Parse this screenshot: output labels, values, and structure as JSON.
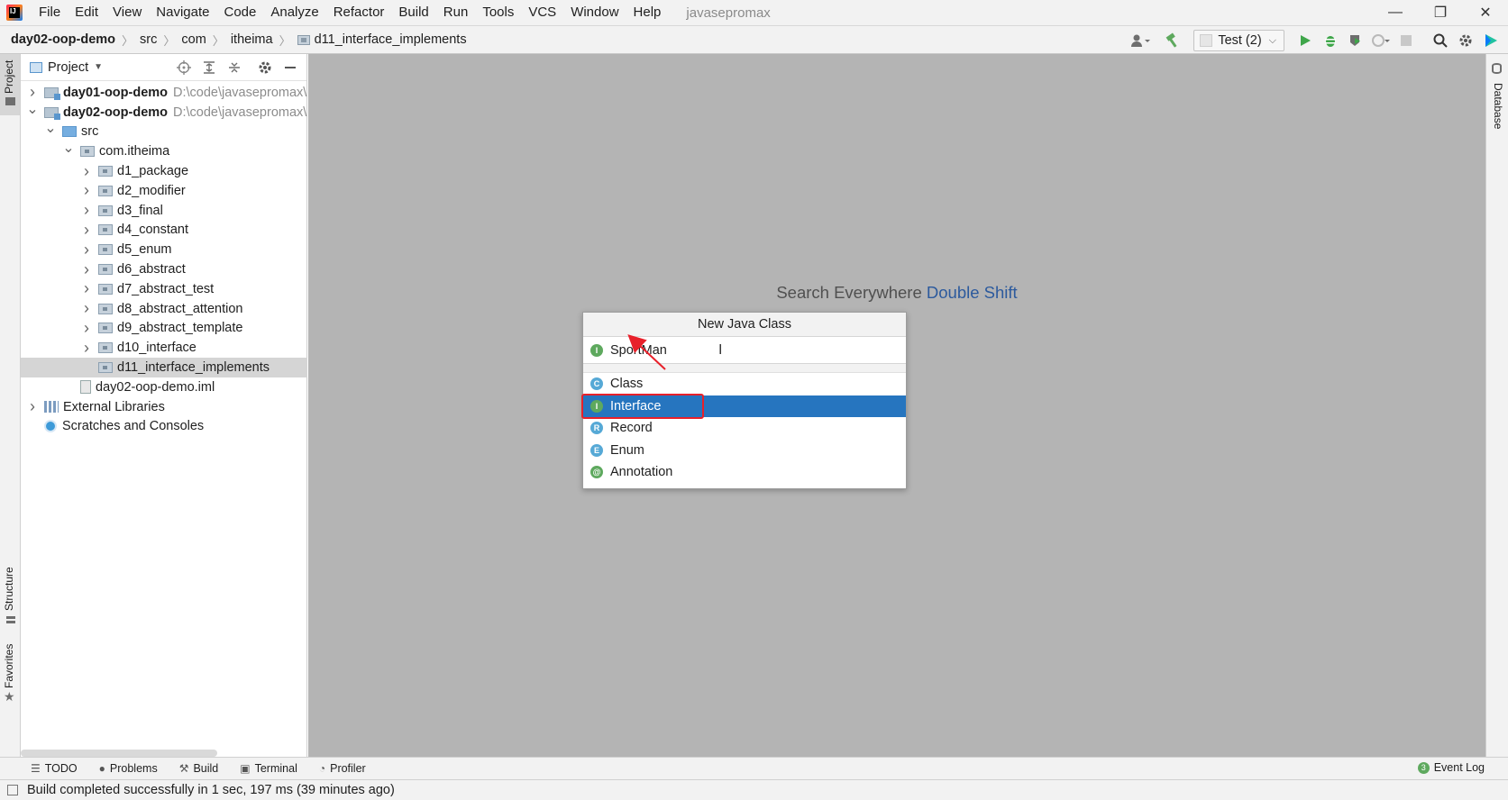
{
  "app": {
    "logo_text": "IJ",
    "project_title": "javasepromax"
  },
  "menu": [
    "File",
    "Edit",
    "View",
    "Navigate",
    "Code",
    "Analyze",
    "Refactor",
    "Build",
    "Run",
    "Tools",
    "VCS",
    "Window",
    "Help"
  ],
  "window_controls": {
    "minimize": "—",
    "restore": "❐",
    "close": "✕"
  },
  "breadcrumb": [
    "day02-oop-demo",
    "src",
    "com",
    "itheima",
    "d11_interface_implements"
  ],
  "toolbar": {
    "run_config": "Test (2)"
  },
  "left_stripe": {
    "project": "Project",
    "structure": "Structure",
    "favorites": "Favorites"
  },
  "right_stripe": {
    "database": "Database"
  },
  "project_panel": {
    "title": "Project",
    "tree": [
      {
        "label": "day01-oop-demo",
        "path": "D:\\code\\javasepromax\\",
        "level": 0,
        "state": "collapsed",
        "kind": "module"
      },
      {
        "label": "day02-oop-demo",
        "path": "D:\\code\\javasepromax\\",
        "level": 0,
        "state": "expanded",
        "kind": "module"
      },
      {
        "label": "src",
        "level": 1,
        "state": "expanded",
        "kind": "src"
      },
      {
        "label": "com.itheima",
        "level": 2,
        "state": "expanded",
        "kind": "package"
      },
      {
        "label": "d1_package",
        "level": 3,
        "state": "collapsed",
        "kind": "package"
      },
      {
        "label": "d2_modifier",
        "level": 3,
        "state": "collapsed",
        "kind": "package"
      },
      {
        "label": "d3_final",
        "level": 3,
        "state": "collapsed",
        "kind": "package"
      },
      {
        "label": "d4_constant",
        "level": 3,
        "state": "collapsed",
        "kind": "package"
      },
      {
        "label": "d5_enum",
        "level": 3,
        "state": "collapsed",
        "kind": "package"
      },
      {
        "label": "d6_abstract",
        "level": 3,
        "state": "collapsed",
        "kind": "package"
      },
      {
        "label": "d7_abstract_test",
        "level": 3,
        "state": "collapsed",
        "kind": "package"
      },
      {
        "label": "d8_abstract_attention",
        "level": 3,
        "state": "collapsed",
        "kind": "package"
      },
      {
        "label": "d9_abstract_template",
        "level": 3,
        "state": "collapsed",
        "kind": "package"
      },
      {
        "label": "d10_interface",
        "level": 3,
        "state": "collapsed",
        "kind": "package"
      },
      {
        "label": "d11_interface_implements",
        "level": 3,
        "state": "leaf",
        "kind": "package",
        "selected": true
      },
      {
        "label": "day02-oop-demo.iml",
        "level": 2,
        "state": "leaf",
        "kind": "file"
      },
      {
        "label": "External Libraries",
        "level": 0,
        "state": "collapsed",
        "kind": "library"
      },
      {
        "label": "Scratches and Consoles",
        "level": 0,
        "state": "leaf",
        "kind": "scratch"
      }
    ]
  },
  "editor": {
    "hint_text": "Search Everywhere",
    "hint_key": "Double Shift"
  },
  "new_class_popup": {
    "title": "New Java Class",
    "input_value": "SportMan",
    "input_kind_letter": "I",
    "options": [
      {
        "label": "Class",
        "letter": "C",
        "kind": "class",
        "selected": false
      },
      {
        "label": "Interface",
        "letter": "I",
        "kind": "interface",
        "selected": true
      },
      {
        "label": "Record",
        "letter": "R",
        "kind": "record",
        "selected": false
      },
      {
        "label": "Enum",
        "letter": "E",
        "kind": "enum",
        "selected": false
      },
      {
        "label": "Annotation",
        "letter": "@",
        "kind": "annotation",
        "selected": false
      }
    ]
  },
  "bottom_tabs": [
    {
      "label": "TODO",
      "icon": "list-icon"
    },
    {
      "label": "Problems",
      "icon": "problems-icon"
    },
    {
      "label": "Build",
      "icon": "hammer-icon"
    },
    {
      "label": "Terminal",
      "icon": "terminal-icon"
    },
    {
      "label": "Profiler",
      "icon": "profiler-icon"
    }
  ],
  "event_log": {
    "label": "Event Log",
    "count": "3"
  },
  "status": {
    "message": "Build completed successfully in 1 sec, 197 ms (39 minutes ago)"
  },
  "colors": {
    "selection_blue": "#2675bf",
    "highlight_red": "#e8202a",
    "editor_bg": "#b4b4b4",
    "hint_key": "#2c5a9d"
  }
}
